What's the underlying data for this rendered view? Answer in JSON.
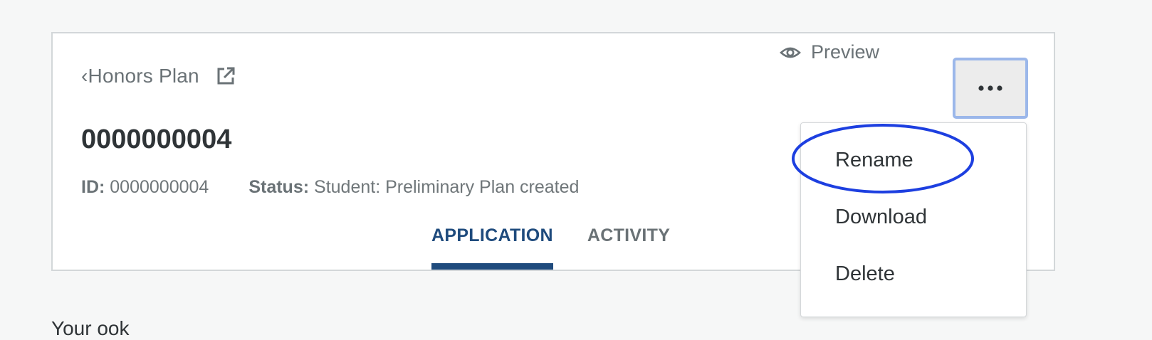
{
  "card": {
    "plan_title": "‹Honors Plan",
    "record_title": "0000000004",
    "meta": {
      "id_label": "ID:",
      "id_value": "0000000004",
      "status_label": "Status:",
      "status_value": "Student: Preliminary Plan created"
    },
    "tabs": [
      {
        "label": "APPLICATION",
        "active": true
      },
      {
        "label": "ACTIVITY",
        "active": false
      }
    ]
  },
  "header_actions": {
    "preview_label": "Preview"
  },
  "menu": {
    "items": [
      "Rename",
      "Download",
      "Delete"
    ]
  },
  "below": {
    "partial_text": "Your ook"
  },
  "colors": {
    "accent": "#1f4b7d",
    "highlight_ring": "#1d3fe0",
    "focus_border": "#9bb7ea"
  }
}
